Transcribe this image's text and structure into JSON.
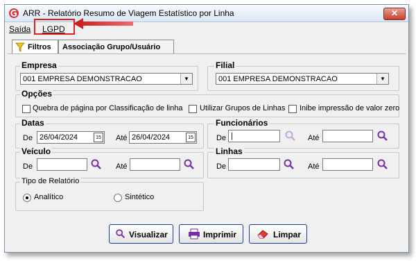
{
  "window": {
    "title": "ARR - Relatório Resumo de Viagem Estatístico por Linha",
    "close_glyph": "✕"
  },
  "menu": [
    {
      "label": "Saída"
    },
    {
      "label": "LGPD"
    }
  ],
  "tabs": [
    {
      "label": "Filtros",
      "active": true
    },
    {
      "label": "Associação Grupo/Usuário"
    }
  ],
  "empresa": {
    "title": "Empresa",
    "value": "001 EMPRESA DEMONSTRACAO"
  },
  "filial": {
    "title": "Filial",
    "value": "001 EMPRESA DEMONSTRACAO"
  },
  "opcoes": {
    "title": "Opções",
    "checks": [
      {
        "label": "Quebra de página por Classificação de linha",
        "checked": false
      },
      {
        "label": "Utilizar Grupos de Linhas",
        "checked": false
      },
      {
        "label": "Inibe impressão de valor zero",
        "checked": false
      }
    ]
  },
  "datas": {
    "title": "Datas",
    "de_label": "De",
    "ate_label": "Até",
    "de_value": "26/04/2024",
    "ate_value": "26/04/2024",
    "cal_glyph": "15"
  },
  "funcionarios": {
    "title": "Funcionários",
    "de_label": "De",
    "ate_label": "Até",
    "de_value": "|",
    "ate_value": ""
  },
  "veiculo": {
    "title": "Veículo",
    "de_label": "De",
    "ate_label": "Até",
    "de_value": "",
    "ate_value": ""
  },
  "linhas": {
    "title": "Linhas",
    "de_label": "De",
    "ate_label": "Até",
    "de_value": "",
    "ate_value": ""
  },
  "tipo": {
    "title": "Tipo de Relatório",
    "options": [
      {
        "label": "Analítico",
        "selected": true
      },
      {
        "label": "Sintético",
        "selected": false
      }
    ]
  },
  "buttons": {
    "visualizar": "Visualizar",
    "imprimir": "Imprimir",
    "limpar": "Limpar"
  },
  "colors": {
    "accent": "#7b2fa8",
    "highlight": "#e02020",
    "button_border": "#1c3b8a"
  }
}
